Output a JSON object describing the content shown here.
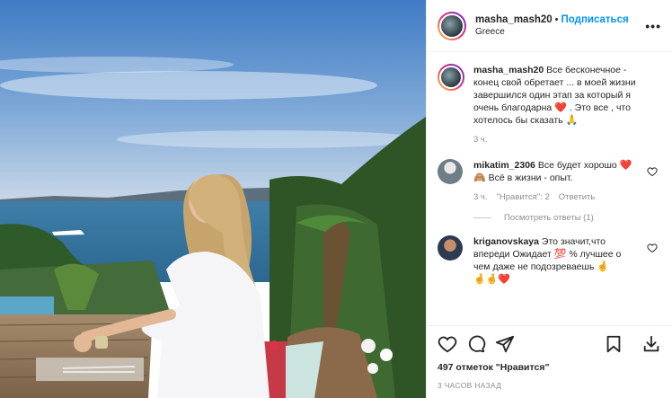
{
  "header": {
    "username": "masha_mash20",
    "separator": "•",
    "follow_label": "Подписаться",
    "location": "Greece",
    "more_icon": "more-horizontal-icon"
  },
  "caption": {
    "username": "masha_mash20",
    "text_1": "Все бесконечное - конец свой обретает ... в моей жизни завершился один этап за который я очень благодарна",
    "emoji_1": "❤️",
    "text_2": ". Это все , что хотелось бы сказать",
    "emoji_2": "🙏",
    "time": "3 ч."
  },
  "comments": [
    {
      "username": "mikatim_2306",
      "text_1": "Все будет хорошо",
      "emoji_1": "❤️🙈",
      "text_2": "Всё в жизни - опыт.",
      "time": "3 ч.",
      "likes": "\"Нравится\": 2",
      "reply_label": "Ответить"
    },
    {
      "username": "kriganovskaya",
      "text_1": "Это значит,что впереди Ожидает",
      "emoji_1": "💯",
      "text_2": "% лучшее о чем даже не подозреваешь",
      "emoji_2": "🤞",
      "emoji_3": "🤞🤞❤️"
    }
  ],
  "view_replies": "Посмотреть ответы (1)",
  "actions": {
    "likes_count": "497 отметок \"Нравится\"",
    "timestamp": "3 ЧАСОВ НАЗАД"
  },
  "colors": {
    "follow": "#0095f6",
    "heart": "#ed4956",
    "muted": "#8e8e8e"
  }
}
